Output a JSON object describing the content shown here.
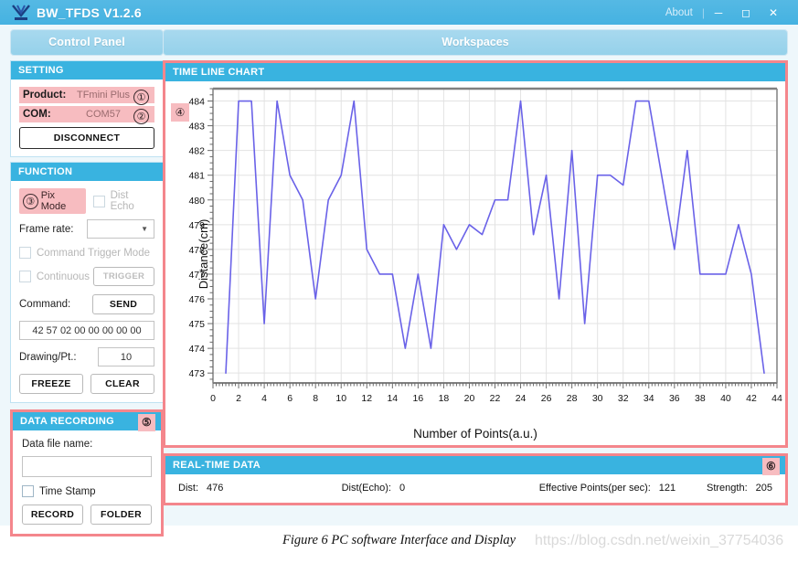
{
  "window": {
    "title": "BW_TFDS V1.2.6",
    "logo_icon": "bluetooth-antenna-icon",
    "about_label": "About",
    "minimize_icon": "minimize-icon",
    "maximize_icon": "maximize-icon",
    "close_icon": "close-icon",
    "titlebar_color": "#4bb5e2"
  },
  "control_panel": {
    "header": "Control Panel",
    "setting": {
      "title": "SETTING",
      "product_label": "Product:",
      "product_value": "TFmini Plus",
      "product_badge": "①",
      "com_label": "COM:",
      "com_value": "COM57",
      "com_badge": "②",
      "disconnect_label": "DISCONNECT"
    },
    "function": {
      "title": "FUNCTION",
      "pix_mode_badge": "③",
      "pix_mode_label": "Pix Mode",
      "dist_echo_label": "Dist Echo",
      "frame_rate_label": "Frame rate:",
      "frame_rate_value": "",
      "command_trigger_label": "Command Trigger Mode",
      "continuous_label": "Continuous",
      "trigger_label": "TRIGGER",
      "command_label": "Command:",
      "send_label": "SEND",
      "command_hex": "42 57 02 00 00 00 00 00",
      "drawing_pt_label": "Drawing/Pt.:",
      "drawing_pt_value": "10",
      "freeze_label": "FREEZE",
      "clear_label": "CLEAR"
    },
    "data_recording": {
      "title": "DATA RECORDING",
      "badge": "⑤",
      "file_name_label": "Data file name:",
      "file_name_value": "",
      "time_stamp_label": "Time Stamp",
      "record_label": "RECORD",
      "folder_label": "FOLDER"
    }
  },
  "workspaces": {
    "header": "Workspaces",
    "time_line_chart": {
      "title": "TIME LINE CHART",
      "badge": "④"
    },
    "real_time_data": {
      "title": "REAL-TIME DATA",
      "badge": "⑥",
      "items": [
        {
          "key": "Dist:",
          "value": "476"
        },
        {
          "key": "Dist(Echo):",
          "value": "0"
        },
        {
          "key": "Effective Points(per sec):",
          "value": "121"
        },
        {
          "key": "Strength:",
          "value": "205"
        }
      ]
    }
  },
  "caption": "Figure 6 PC software Interface and Display",
  "watermark": "https://blog.csdn.net/weixin_37754036",
  "colors": {
    "accent_blue": "#39b3e0",
    "highlight_red": "#f4868c",
    "pink_field": "#f7bcc0",
    "line_color": "#6a62e8"
  },
  "chart_data": {
    "type": "line",
    "title": "TIME LINE CHART",
    "xlabel": "Number of Points(a.u.)",
    "ylabel": "Distance(cm)",
    "xlim": [
      0,
      44
    ],
    "ylim": [
      472.6,
      484.5
    ],
    "xticks": [
      0,
      2,
      4,
      6,
      8,
      10,
      12,
      14,
      16,
      18,
      20,
      22,
      24,
      26,
      28,
      30,
      32,
      34,
      36,
      38,
      40,
      42,
      44
    ],
    "yticks": [
      473,
      474,
      475,
      476,
      477,
      478,
      479,
      480,
      481,
      482,
      483,
      484
    ],
    "grid": true,
    "legend": false,
    "line_color": "#6a62e8",
    "x": [
      1,
      2,
      3,
      4,
      5,
      6,
      7,
      8,
      9,
      10,
      11,
      12,
      13,
      14,
      15,
      16,
      17,
      18,
      19,
      20,
      21,
      22,
      23,
      24,
      25,
      26,
      27,
      28,
      29,
      30,
      31,
      32,
      33,
      34,
      35,
      36,
      37,
      38,
      39,
      40,
      41,
      42,
      43
    ],
    "values": [
      473,
      484,
      484,
      475,
      484,
      481,
      480,
      476,
      480,
      481,
      484,
      478,
      477,
      477,
      474,
      477,
      474,
      479,
      478,
      479,
      478.6,
      480,
      480,
      484,
      478.6,
      481,
      476,
      482,
      475,
      481,
      481,
      480.6,
      484,
      484,
      481,
      478,
      482,
      477,
      477,
      477,
      479,
      477,
      473
    ]
  }
}
